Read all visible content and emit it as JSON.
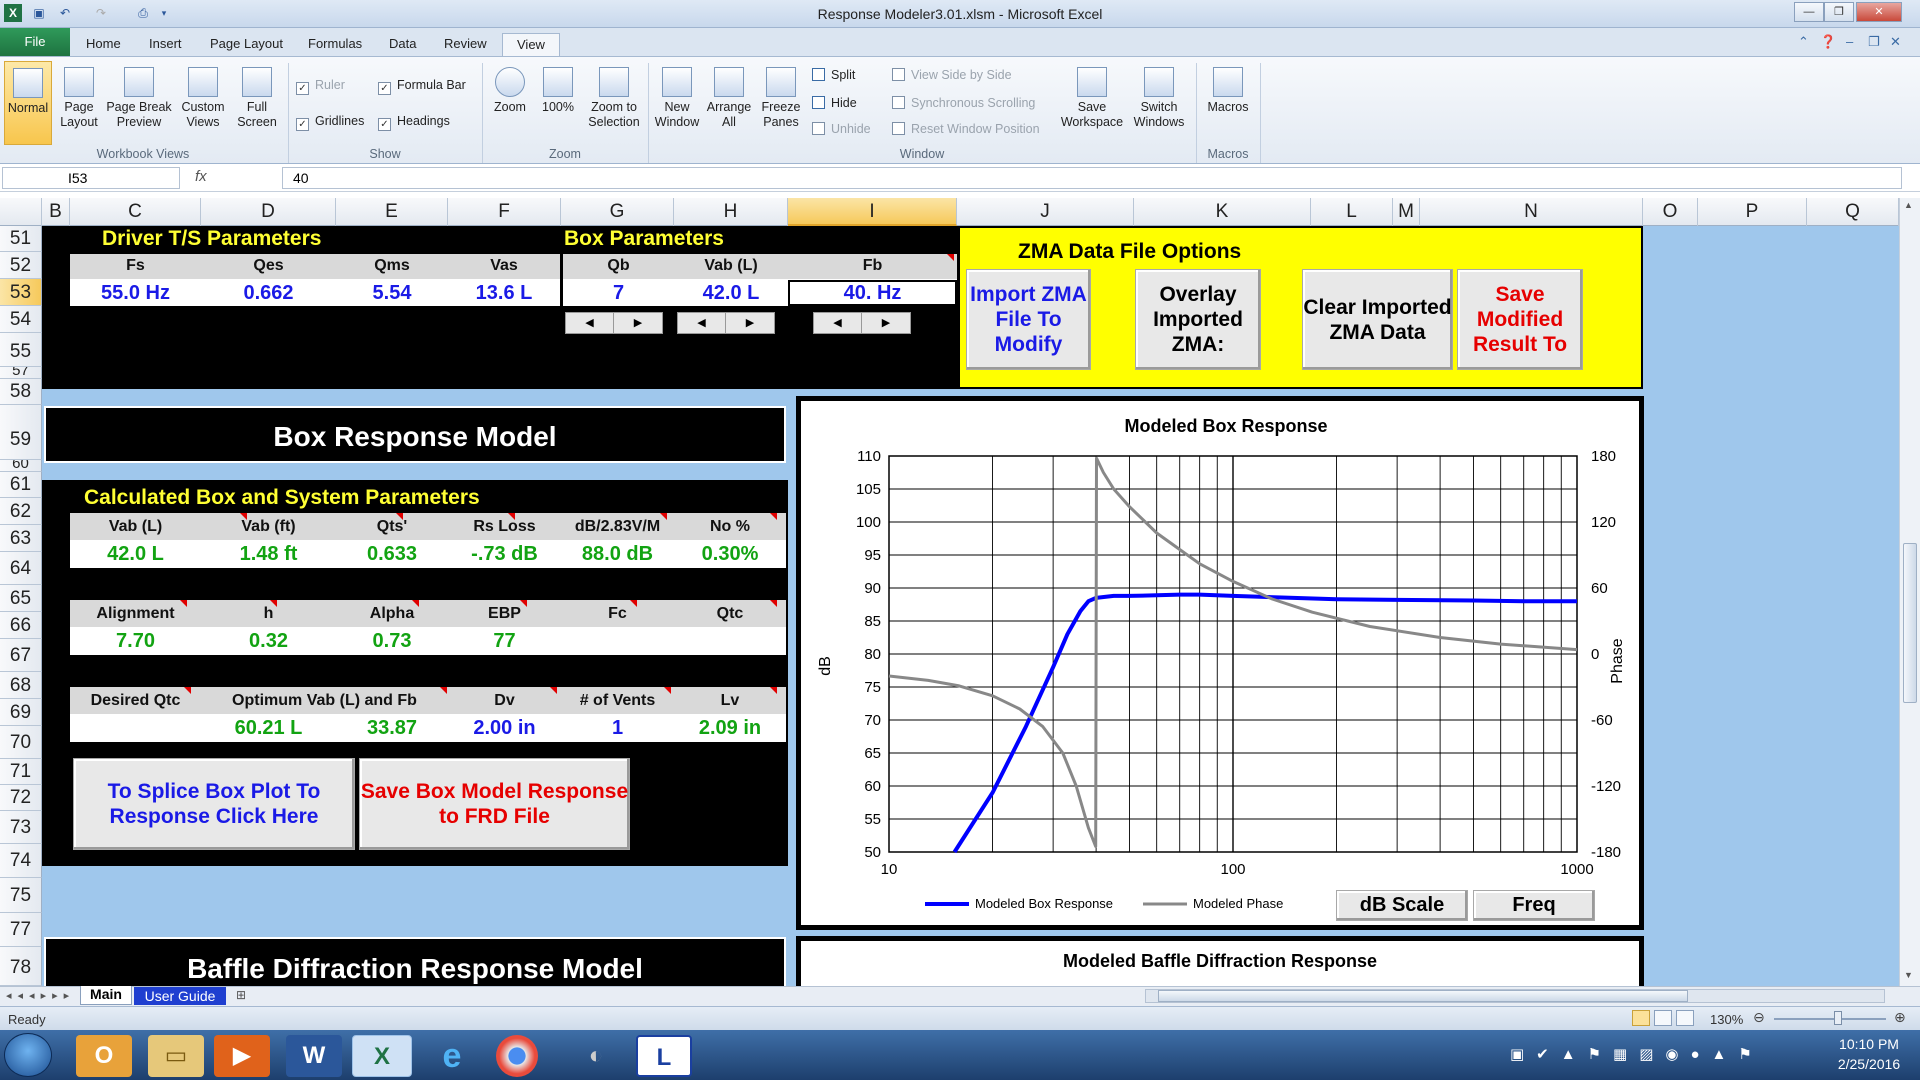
{
  "window": {
    "title": "Response Modeler3.01.xlsm  -  Microsoft Excel",
    "minimize": "—",
    "restore": "❐",
    "close": "✕"
  },
  "tabs": [
    "File",
    "Home",
    "Insert",
    "Page Layout",
    "Formulas",
    "Data",
    "Review",
    "View"
  ],
  "ribbon": {
    "workbook_views": {
      "label": "Workbook Views",
      "normal": "Normal",
      "page_layout": "Page Layout",
      "page_break": "Page Break Preview",
      "custom": "Custom Views",
      "full": "Full Screen"
    },
    "show": {
      "label": "Show",
      "ruler": "Ruler",
      "formula_bar": "Formula Bar",
      "gridlines": "Gridlines",
      "headings": "Headings"
    },
    "zoom": {
      "label": "Zoom",
      "zoom": "Zoom",
      "hundred": "100%",
      "zoom_sel": "Zoom to Selection"
    },
    "window": {
      "label": "Window",
      "new": "New Window",
      "arrange": "Arrange All",
      "freeze": "Freeze Panes",
      "split": "Split",
      "hide": "Hide",
      "unhide": "Unhide",
      "side": "View Side by Side",
      "sync": "Synchronous Scrolling",
      "reset": "Reset Window Position",
      "save_ws": "Save Workspace",
      "switch": "Switch Windows"
    },
    "macros": {
      "label": "Macros",
      "macros": "Macros"
    }
  },
  "formula_bar": {
    "name_box": "I53",
    "fx": "fx",
    "value": "40"
  },
  "columns": [
    "B",
    "C",
    "D",
    "E",
    "F",
    "G",
    "H",
    "I",
    "J",
    "K",
    "L",
    "M",
    "N",
    "O",
    "P",
    "Q"
  ],
  "rows": [
    "51",
    "52",
    "53",
    "54",
    "55",
    "57",
    "58",
    "59",
    "60",
    "61",
    "62",
    "63",
    "64",
    "65",
    "66",
    "67",
    "68",
    "69",
    "70",
    "71",
    "72",
    "73",
    "74",
    "75",
    "77",
    "78"
  ],
  "driver": {
    "title": "Driver T/S Parameters",
    "headers": [
      "Fs",
      "Qes",
      "Qms",
      "Vas"
    ],
    "values": [
      "55.0 Hz",
      "0.662",
      "5.54",
      "13.6 L"
    ]
  },
  "box": {
    "title": "Box Parameters",
    "headers": [
      "Qb",
      "Vab (L)",
      "Fb"
    ],
    "values": [
      "7",
      "42.0 L",
      "40. Hz"
    ],
    "spin_left": "◀",
    "spin_right": "▶"
  },
  "zma": {
    "title": "ZMA Data File Options",
    "import": "Import ZMA File To Modify",
    "overlay": "Overlay Imported ZMA:",
    "clear": "Clear Imported ZMA Data",
    "save": "Save Modified Result To"
  },
  "box_model": {
    "title": "Box Response Model",
    "calc_title": "Calculated Box and System Parameters",
    "h1": [
      "Vab (L)",
      "Vab (ft)",
      "Qts'",
      "Rs Loss",
      "dB/2.83V/M",
      "No %"
    ],
    "v1": [
      "42.0 L",
      "1.48 ft",
      "0.633",
      "-.73 dB",
      "88.0 dB",
      "0.30%"
    ],
    "h2": [
      "Alignment",
      "h",
      "Alpha",
      "EBP",
      "Fc",
      "Qtc"
    ],
    "v2": [
      "7.70",
      "0.32",
      "0.73",
      "77",
      "",
      ""
    ],
    "h3": [
      "Desired Qtc",
      "Optimum Vab (L) and Fb",
      "",
      "Dv",
      "# of Vents",
      "Lv"
    ],
    "v3": [
      "",
      "60.21 L",
      "33.87",
      "2.00 in",
      "1",
      "2.09 in"
    ],
    "splice": "To Splice Box Plot To Response Click Here",
    "save_frd": "Save Box Model Response to FRD File"
  },
  "baffle": {
    "title": "Baffle Diffraction Response Model",
    "chart_title": "Modeled Baffle Diffraction Response"
  },
  "chart_data": {
    "type": "line",
    "title": "Modeled Box Response",
    "xlabel": "",
    "ylabel": "dB",
    "y2label": "Phase",
    "xscale": "log",
    "xlim": [
      10,
      1000
    ],
    "ylim": [
      50,
      110
    ],
    "y2lim": [
      -180,
      180
    ],
    "x_ticks": [
      "10",
      "100",
      "1000"
    ],
    "y_ticks": [
      "110",
      "105",
      "100",
      "95",
      "90",
      "85",
      "80",
      "75",
      "70",
      "65",
      "60",
      "55",
      "50"
    ],
    "y2_ticks": [
      "180",
      "120",
      "60",
      "0",
      "-60",
      "-120",
      "-180"
    ],
    "series": [
      {
        "name": "Modeled Box Response",
        "color": "#0000ff",
        "axis": "y",
        "x": [
          15.5,
          20,
          25,
          30,
          33,
          36,
          38,
          40,
          45,
          50,
          60,
          70,
          80,
          100,
          150,
          200,
          300,
          500,
          700,
          1000
        ],
        "y": [
          50,
          59,
          69,
          78,
          83,
          86.5,
          88,
          88.5,
          88.8,
          88.8,
          88.9,
          89,
          89,
          88.8,
          88.5,
          88.3,
          88.2,
          88.1,
          88,
          88
        ]
      },
      {
        "name": "Modeled Phase",
        "color": "#888888",
        "axis": "y2",
        "x": [
          10,
          13,
          16,
          20,
          24,
          28,
          32,
          35,
          38,
          39.9,
          40.1,
          42,
          45,
          50,
          60,
          70,
          80,
          100,
          130,
          170,
          250,
          400,
          600,
          1000
        ],
        "y": [
          -20,
          -24,
          -29,
          -38,
          -50,
          -66,
          -90,
          -120,
          -158,
          -175,
          178,
          165,
          150,
          134,
          110,
          95,
          82,
          66,
          50,
          38,
          25,
          15,
          9,
          4
        ]
      }
    ],
    "legend": "bottom",
    "grid": true
  },
  "chart_buttons": {
    "db_scale": "dB Scale",
    "freq": "Freq"
  },
  "sheets": {
    "main": "Main",
    "guide": "User Guide"
  },
  "status": {
    "ready": "Ready",
    "zoom": "130%"
  },
  "clock": {
    "time": "10:10 PM",
    "date": "2/25/2016"
  }
}
